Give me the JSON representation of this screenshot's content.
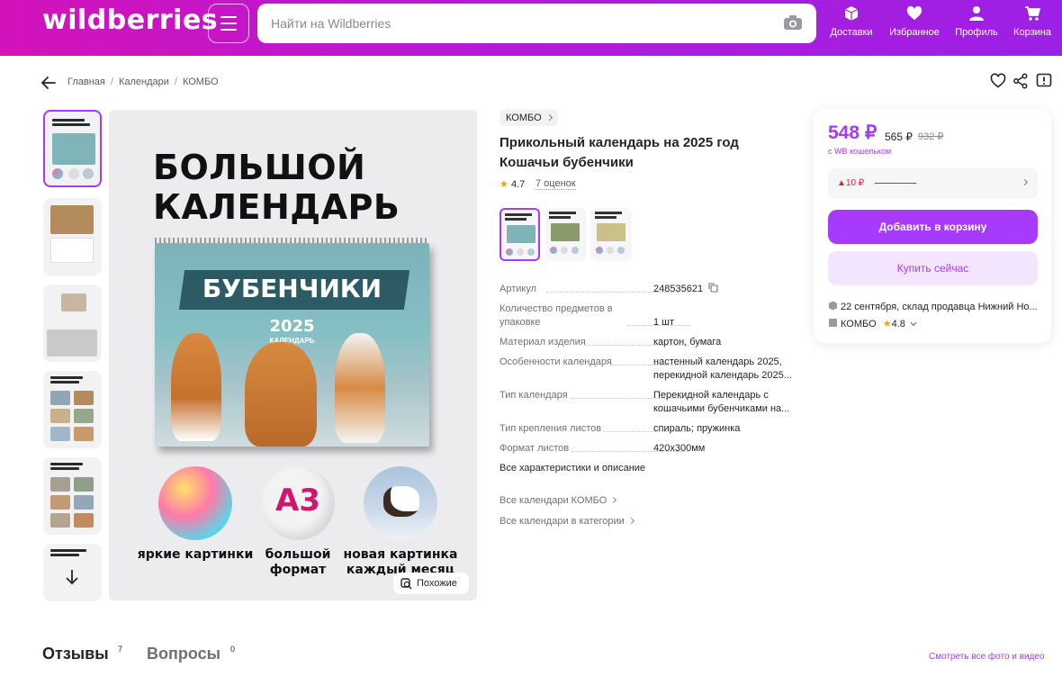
{
  "header": {
    "logo": "wildberries",
    "search_placeholder": "Найти на Wildberries",
    "nav": [
      {
        "label": "Доставки",
        "icon": "box-icon"
      },
      {
        "label": "Избранное",
        "icon": "heart-icon"
      },
      {
        "label": "Профиль",
        "icon": "user-icon"
      },
      {
        "label": "Корзина",
        "icon": "cart-icon"
      }
    ]
  },
  "breadcrumb": {
    "items": [
      "Главная",
      "Календари",
      "КОМБО"
    ]
  },
  "gallery": {
    "headline": "БОЛЬШОЙ КАЛЕНДАРЬ",
    "calendar_name": "БУБЕНЧИКИ",
    "calendar_year": "2025",
    "calendar_sub": "КАЛЕНДАРЬ",
    "features": [
      "яркие картинки",
      "большой формат",
      "новая картинка каждый месяц"
    ],
    "a3_label": "A3",
    "similar_label": "Похожие"
  },
  "product": {
    "brand": "КОМБО",
    "title": "Прикольный календарь на 2025 год Кошачьи бубенчики",
    "rating": "4.7",
    "reviews": "7 оценок",
    "specs": [
      {
        "key": "Артикул",
        "value": "248535621"
      },
      {
        "key": "Количество предметов в упаковке",
        "value": "1 шт"
      },
      {
        "key": "Материал изделия",
        "value": "картон, бумага"
      },
      {
        "key": "Особенности календаря",
        "value": "настенный календарь 2025, перекидной календарь 2025..."
      },
      {
        "key": "Тип календаря",
        "value": "Перекидной календарь с кошачьими бубенчиками на..."
      },
      {
        "key": "Тип крепления листов",
        "value": "спираль; пружинка"
      },
      {
        "key": "Формат листов",
        "value": "420x300мм"
      }
    ],
    "all_specs_link": "Все характеристики и описание",
    "brand_link": "Все календари КОМБО",
    "category_link": "Все календари в категории"
  },
  "price_card": {
    "price": "548 ₽",
    "price_no_wallet": "565 ₽",
    "price_old": "932 ₽",
    "wallet_note": "с WB кошельком",
    "bonus": "▲10 ₽",
    "add_to_cart": "Добавить в корзину",
    "buy_now": "Купить сейчас",
    "delivery": "22 сентября, склад продавца Нижний Но...",
    "seller": "КОМБО",
    "seller_rating": "4.8"
  },
  "bottom": {
    "reviews_tab": "Отзывы",
    "reviews_count": "7",
    "questions_tab": "Вопросы",
    "questions_count": "0",
    "all_media_link": "Смотреть все фото и видео"
  },
  "colors": {
    "accent": "#a73afd",
    "header_start": "#d312b9",
    "header_end": "#9c20e6",
    "bonus_red": "#e0233b"
  }
}
